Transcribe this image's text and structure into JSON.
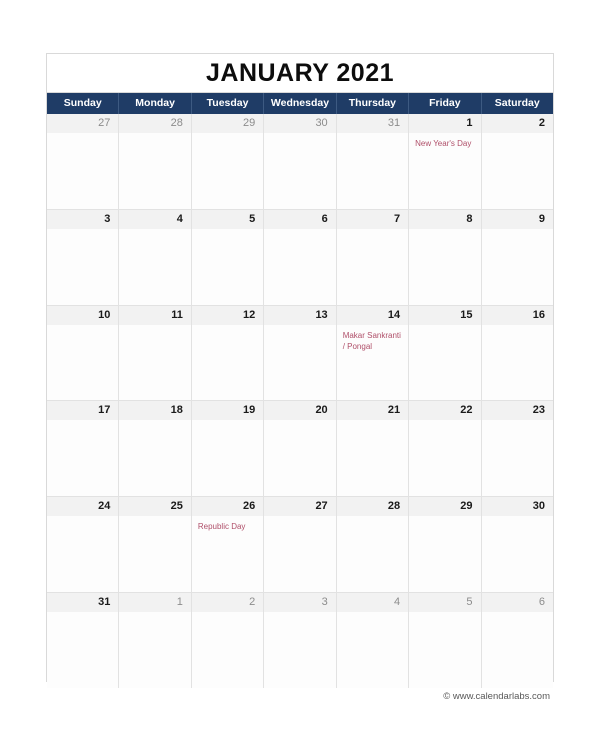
{
  "calendar": {
    "title": "JANUARY 2021",
    "month": "January",
    "year": "2021",
    "weekdays": [
      {
        "label": "Sunday"
      },
      {
        "label": "Monday"
      },
      {
        "label": "Tuesday"
      },
      {
        "label": "Wednesday"
      },
      {
        "label": "Thursday"
      },
      {
        "label": "Friday"
      },
      {
        "label": "Saturday"
      }
    ],
    "colors": {
      "header_bg": "#1f3c66",
      "header_text": "#ffffff",
      "date_band_bg": "#f2f2f2",
      "cell_bg": "#fdfdfd",
      "grid_border": "#e2e2e2",
      "frame_border": "#d9d9d9",
      "date_text": "#1a1a1a",
      "other_month_text": "#8c8c8c",
      "event_text": "#b0506a",
      "title_text": "#0d0d0d",
      "footer_text": "#595959"
    },
    "weeks": [
      {
        "days": [
          {
            "date": "27",
            "current_month": false,
            "events": []
          },
          {
            "date": "28",
            "current_month": false,
            "events": []
          },
          {
            "date": "29",
            "current_month": false,
            "events": []
          },
          {
            "date": "30",
            "current_month": false,
            "events": []
          },
          {
            "date": "31",
            "current_month": false,
            "events": []
          },
          {
            "date": "1",
            "current_month": true,
            "events": [
              "New Year's Day"
            ]
          },
          {
            "date": "2",
            "current_month": true,
            "events": []
          }
        ]
      },
      {
        "days": [
          {
            "date": "3",
            "current_month": true,
            "events": []
          },
          {
            "date": "4",
            "current_month": true,
            "events": []
          },
          {
            "date": "5",
            "current_month": true,
            "events": []
          },
          {
            "date": "6",
            "current_month": true,
            "events": []
          },
          {
            "date": "7",
            "current_month": true,
            "events": []
          },
          {
            "date": "8",
            "current_month": true,
            "events": []
          },
          {
            "date": "9",
            "current_month": true,
            "events": []
          }
        ]
      },
      {
        "days": [
          {
            "date": "10",
            "current_month": true,
            "events": []
          },
          {
            "date": "11",
            "current_month": true,
            "events": []
          },
          {
            "date": "12",
            "current_month": true,
            "events": []
          },
          {
            "date": "13",
            "current_month": true,
            "events": []
          },
          {
            "date": "14",
            "current_month": true,
            "events": [
              "Makar Sankranti / Pongal"
            ]
          },
          {
            "date": "15",
            "current_month": true,
            "events": []
          },
          {
            "date": "16",
            "current_month": true,
            "events": []
          }
        ]
      },
      {
        "days": [
          {
            "date": "17",
            "current_month": true,
            "events": []
          },
          {
            "date": "18",
            "current_month": true,
            "events": []
          },
          {
            "date": "19",
            "current_month": true,
            "events": []
          },
          {
            "date": "20",
            "current_month": true,
            "events": []
          },
          {
            "date": "21",
            "current_month": true,
            "events": []
          },
          {
            "date": "22",
            "current_month": true,
            "events": []
          },
          {
            "date": "23",
            "current_month": true,
            "events": []
          }
        ]
      },
      {
        "days": [
          {
            "date": "24",
            "current_month": true,
            "events": []
          },
          {
            "date": "25",
            "current_month": true,
            "events": []
          },
          {
            "date": "26",
            "current_month": true,
            "events": [
              "Republic Day"
            ]
          },
          {
            "date": "27",
            "current_month": true,
            "events": []
          },
          {
            "date": "28",
            "current_month": true,
            "events": []
          },
          {
            "date": "29",
            "current_month": true,
            "events": []
          },
          {
            "date": "30",
            "current_month": true,
            "events": []
          }
        ]
      },
      {
        "days": [
          {
            "date": "31",
            "current_month": true,
            "events": []
          },
          {
            "date": "1",
            "current_month": false,
            "events": []
          },
          {
            "date": "2",
            "current_month": false,
            "events": []
          },
          {
            "date": "3",
            "current_month": false,
            "events": []
          },
          {
            "date": "4",
            "current_month": false,
            "events": []
          },
          {
            "date": "5",
            "current_month": false,
            "events": []
          },
          {
            "date": "6",
            "current_month": false,
            "events": []
          }
        ]
      }
    ]
  },
  "footer": {
    "credit": "© www.calendarlabs.com"
  }
}
